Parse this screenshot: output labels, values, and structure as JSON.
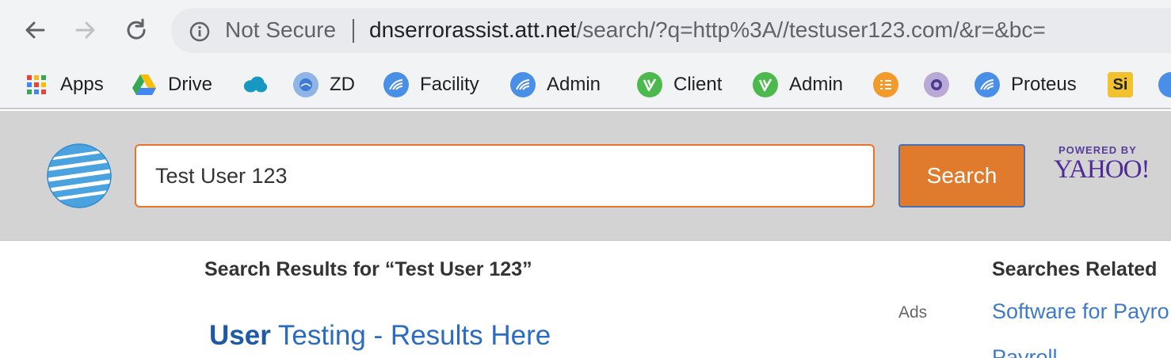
{
  "browser": {
    "back_icon": "arrow-left-icon",
    "forward_icon": "arrow-right-icon",
    "reload_icon": "reload-icon",
    "security_label": "Not Secure",
    "url_host": "dnserrorassist.att.net",
    "url_path": "/search/?q=http%3A//testuser123.com/&r=&bc="
  },
  "bookmarks": [
    {
      "label": "Apps",
      "icon": "apps-grid-icon"
    },
    {
      "label": "Drive",
      "icon": "google-drive-icon"
    },
    {
      "label": "",
      "icon": "salesforce-cloud-icon"
    },
    {
      "label": "ZD",
      "icon": "zd-globe-icon"
    },
    {
      "label": "Facility",
      "icon": "facility-wave-icon"
    },
    {
      "label": "Admin",
      "icon": "admin-wave-icon"
    },
    {
      "label": "Client",
      "icon": "client-v-icon"
    },
    {
      "label": "Admin",
      "icon": "admin-v-icon"
    },
    {
      "label": "",
      "icon": "checklist-icon"
    },
    {
      "label": "",
      "icon": "purple-circle-icon"
    },
    {
      "label": "Proteus",
      "icon": "proteus-wave-icon"
    },
    {
      "label": "",
      "icon": "si-icon"
    }
  ],
  "search": {
    "query": "Test User 123",
    "button_label": "Search",
    "powered_by": "POWERED BY",
    "provider": "YAHOO!"
  },
  "results": {
    "heading": "Search Results for “Test User 123”",
    "ads_label": "Ads",
    "first_result_bold": "User",
    "first_result_rest": " Testing - Results Here"
  },
  "related": {
    "heading": "Searches Related",
    "items": [
      "Software for Payro",
      "Payroll ..."
    ]
  },
  "colors": {
    "search_button": "#e07a2c",
    "search_border": "#e8742b",
    "link": "#2a6bc4",
    "yahoo": "#4f2b99"
  }
}
